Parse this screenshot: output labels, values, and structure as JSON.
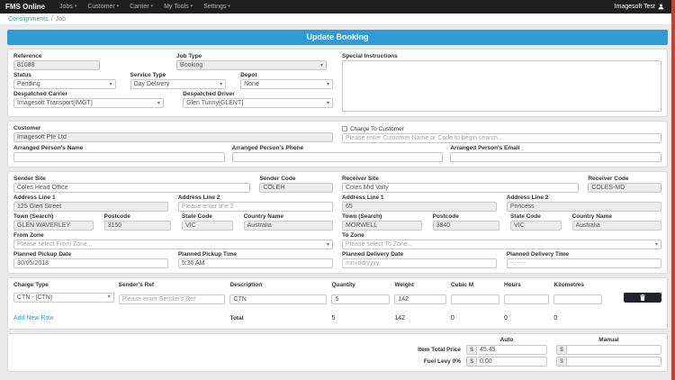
{
  "navbar": {
    "brand": "FMS Online",
    "items": [
      {
        "label": "Jobs"
      },
      {
        "label": "Customer"
      },
      {
        "label": "Carrier"
      },
      {
        "label": "My Tools"
      },
      {
        "label": "Settings"
      }
    ],
    "user": "Imagesoft Test"
  },
  "breadcrumb": {
    "parent": "Consignments",
    "separator": "/",
    "current": "Job"
  },
  "title": "Update Booking",
  "details": {
    "reference_label": "Reference",
    "reference_value": "81088",
    "job_type_label": "Job Type",
    "job_type_value": "Booking",
    "special_instructions_label": "Special Instructions",
    "status_label": "Status",
    "status_value": "Pending",
    "service_type_label": "Service Type",
    "service_type_value": "Day Delivery",
    "depot_label": "Depot",
    "depot_value": "None",
    "carrier_label": "Despatched Carrier",
    "carrier_value": "Imagesoft Transport[IMGT]",
    "driver_label": "Despatched Driver",
    "driver_value": "Glen Tunny[GLENT]"
  },
  "customer": {
    "customer_label": "Customer",
    "customer_value": "Imagesoft Pte Ltd",
    "charge_to_label": "Charge To Customer",
    "charge_to_placeholder": "Please enter Customer Name or Code to begin search...",
    "name_label": "Arranged Person's Name",
    "phone_label": "Arranged Person's Phone",
    "email_label": "Arranged Person's Email"
  },
  "sender": {
    "site_label": "Sender Site",
    "site_value": "Coles Head Office",
    "code_label": "Sender Code",
    "code_value": "COLEH",
    "addr1_label": "Address Line 1",
    "addr1_value": "125 Glen Street",
    "addr2_label": "Address Line 2",
    "addr2_placeholder": "Please enter line 2",
    "town_label": "Town (Search)",
    "town_value": "GLEN WAVERLEY",
    "postcode_label": "Postcode",
    "postcode_value": "3150",
    "state_label": "State Code",
    "state_value": "VIC",
    "country_label": "Country Name",
    "country_value": "Australia",
    "zone_label": "From Zone",
    "zone_placeholder": "Please select From Zone...",
    "pickup_date_label": "Planned Pickup Date",
    "pickup_date_value": "30/05/2018",
    "pickup_time_label": "Planned Pickup Time",
    "pickup_time_value": "5:36 AM"
  },
  "receiver": {
    "site_label": "Receiver Site",
    "site_value": "Coles Mid Vally",
    "code_label": "Receiver Code",
    "code_value": "COLES-MD",
    "addr1_label": "Address Line 1",
    "addr1_value": "65",
    "addr2_label": "Address Line 2",
    "addr2_value": "Princess",
    "town_label": "Town (Search)",
    "town_value": "MORWELL",
    "postcode_label": "Postcode",
    "postcode_value": "3840",
    "state_label": "State Code",
    "state_value": "VIC",
    "country_label": "Country Name",
    "country_value": "Australia",
    "zone_label": "To Zone",
    "zone_placeholder": "Please select To Zone...",
    "delivery_date_label": "Planned Delivery Date",
    "delivery_date_placeholder": "mm/dd/yyyy",
    "delivery_time_label": "Planned Delivery Time",
    "delivery_time_placeholder": "--:-- --"
  },
  "charges": {
    "headers": [
      "Charge Type",
      "Sender's Ref",
      "Description",
      "Quantity",
      "Weight",
      "Cubic M",
      "Hours",
      "Kilometres"
    ],
    "row": {
      "charge_type": "CTN - [CTN]",
      "senders_ref_placeholder": "Please enter Sender's Ref",
      "description": "CTN",
      "quantity": "5",
      "weight": "142"
    },
    "add_new_row": "Add New Row",
    "total_label": "Total",
    "total_quantity": "5",
    "total_weight": "142",
    "total_cubic_m": "0",
    "total_hours": "0",
    "total_kilometres": "0"
  },
  "pricing": {
    "auto_header": "Auto",
    "manual_header": "Manual",
    "currency": "$",
    "rows": [
      {
        "label": "Item Total Price",
        "auto": "45.45"
      },
      {
        "label": "Fuel Levy 0%",
        "auto": "0.00"
      }
    ]
  },
  "colors": {
    "accent_blue": "#2e9bd6",
    "navbar": "#1f1f1f",
    "edge_strip": "#bf4438"
  }
}
